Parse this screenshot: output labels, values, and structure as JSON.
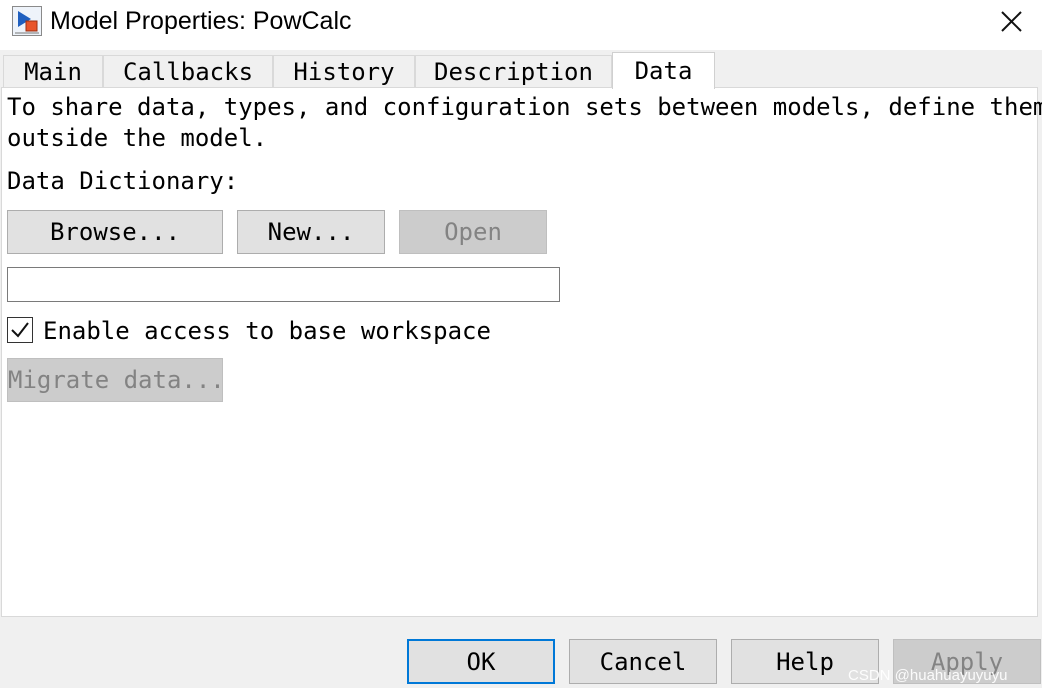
{
  "window": {
    "title": "Model Properties: PowCalc",
    "icon": "simulink-model-icon",
    "close_icon": "close-icon"
  },
  "tabs": [
    {
      "label": "Main",
      "active": false
    },
    {
      "label": "Callbacks",
      "active": false
    },
    {
      "label": "History",
      "active": false
    },
    {
      "label": "Description",
      "active": false
    },
    {
      "label": "Data",
      "active": true
    }
  ],
  "data_tab": {
    "description_line1": "To share data, types, and configuration sets between models, define them",
    "description_line2": "outside the model.",
    "dictionary_label": "Data Dictionary:",
    "browse_label": "Browse...",
    "new_label": "New...",
    "open_label": "Open",
    "dictionary_path_value": "",
    "enable_base_workspace_label": "Enable access to base workspace",
    "enable_base_workspace_checked": true,
    "migrate_label": "Migrate data..."
  },
  "footer": {
    "ok_label": "OK",
    "cancel_label": "Cancel",
    "help_label": "Help",
    "apply_label": "Apply"
  },
  "watermark": "CSDN @huahuayuyuyu",
  "colors": {
    "dialog_bg": "#f0f0f0",
    "panel_bg": "#ffffff",
    "button_bg": "#e1e1e1",
    "disabled_button_bg": "#cccccc",
    "disabled_text": "#838383",
    "default_button_border": "#0078d7"
  }
}
